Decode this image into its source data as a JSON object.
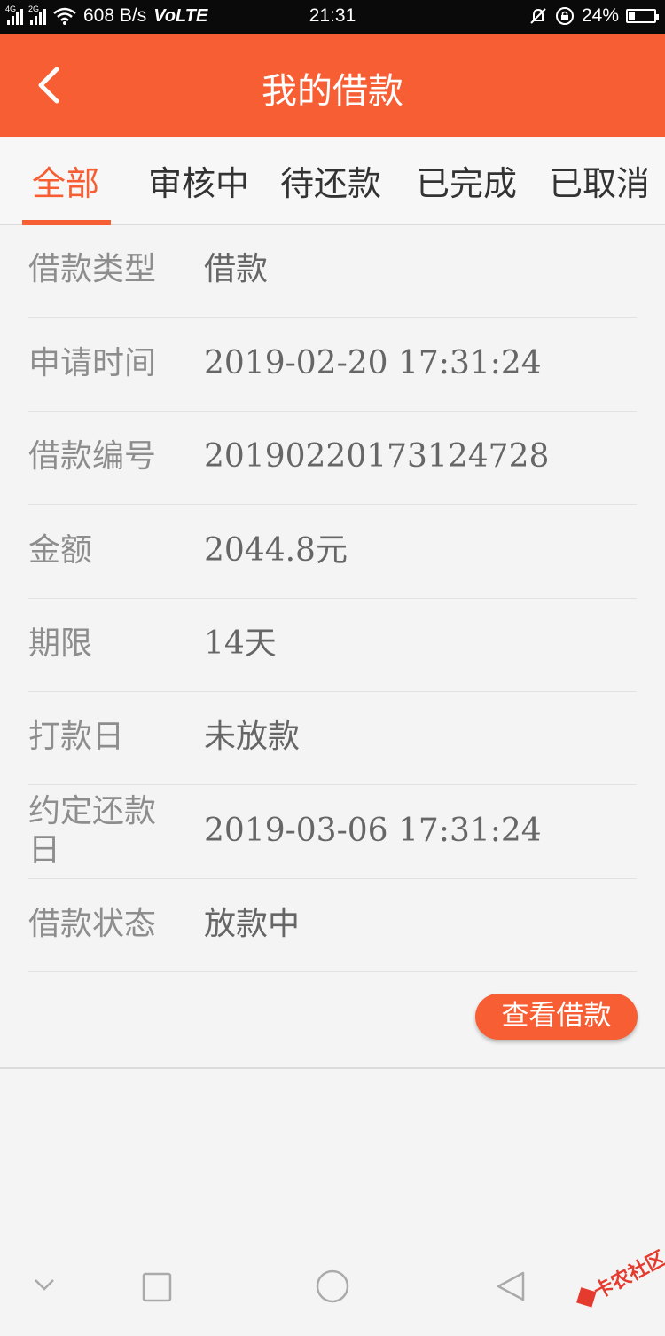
{
  "status_bar": {
    "network_labels": [
      "4G",
      "2G"
    ],
    "speed": "608 B/s",
    "volte": "VoLTE",
    "time": "21:31",
    "battery": "24%",
    "battery_level": 0.24
  },
  "app_bar": {
    "title": "我的借款",
    "back_icon": "chevron-left-icon"
  },
  "tabs": [
    {
      "label": "全部",
      "active": true
    },
    {
      "label": "审核中",
      "active": false
    },
    {
      "label": "待还款",
      "active": false
    },
    {
      "label": "已完成",
      "active": false
    },
    {
      "label": "已取消",
      "active": false
    }
  ],
  "details": [
    {
      "label": "借款类型",
      "value": "借款"
    },
    {
      "label": "申请时间",
      "value": "2019-02-20 17:31:24"
    },
    {
      "label": "借款编号",
      "value": "20190220173124728"
    },
    {
      "label": "金额",
      "value": "2044.8元"
    },
    {
      "label": "期限",
      "value": "14天"
    },
    {
      "label": "打款日",
      "value": "未放款"
    },
    {
      "label": "约定还款日",
      "value": "2019-03-06 17:31:24"
    },
    {
      "label": "借款状态",
      "value": "放款中"
    }
  ],
  "action_button": "查看借款",
  "colors": {
    "brand": "#f75e33",
    "label": "#8d8d8d",
    "value": "#666666"
  },
  "watermark": "卡农社区"
}
